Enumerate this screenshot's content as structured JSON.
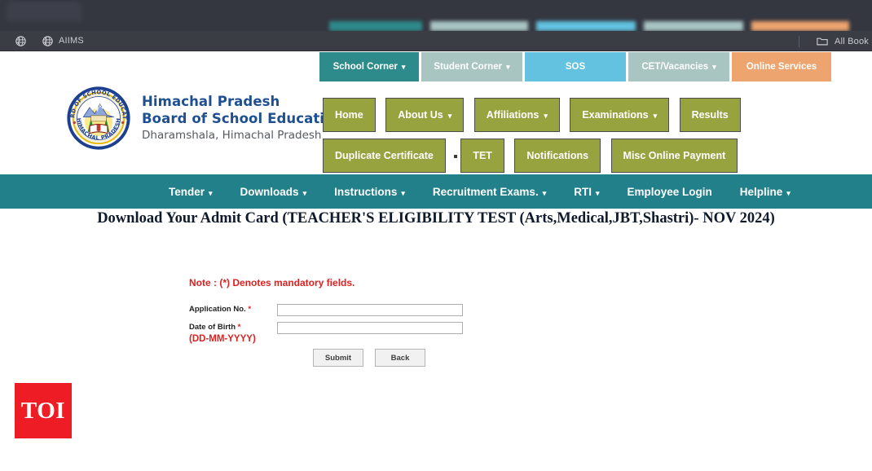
{
  "browser": {
    "bookmarks": [
      {
        "icon": "globe-icon",
        "label": ""
      },
      {
        "icon": "globe-icon",
        "label": "AIIMS"
      }
    ],
    "all_bookmarks_label": "All Book",
    "all_bookmarks_icon": "folder-icon"
  },
  "top_nav": {
    "items": [
      {
        "label": "School Corner",
        "caret": true,
        "color": "#2e8b8b"
      },
      {
        "label": "Student Corner",
        "caret": true,
        "color": "#a9c5c2"
      },
      {
        "label": "SOS",
        "caret": false,
        "color": "#62c2e0"
      },
      {
        "label": "CET/Vacancies",
        "caret": true,
        "color": "#a9c5c2"
      },
      {
        "label": "Online Services",
        "caret": false,
        "color": "#eda46e"
      }
    ]
  },
  "header": {
    "logo_name": "board-seal-logo",
    "logo_outer_text_top": "BOARD OF SCHOOL EDUCATION",
    "logo_outer_text_bottom": "HIMACHAL PRADESH",
    "brand_line1": "Himachal Pradesh",
    "brand_line2": "Board of School Education",
    "brand_line3": "Dharamshala, Himachal Pradesh",
    "brand_color": "#1d4f91"
  },
  "main_nav": {
    "button_color": "#97a33f",
    "items": [
      {
        "label": "Home",
        "caret": false
      },
      {
        "label": "About Us",
        "caret": true
      },
      {
        "label": "Affiliations",
        "caret": true
      },
      {
        "label": "Examinations",
        "caret": true
      },
      {
        "label": "Results",
        "caret": false
      },
      {
        "label": "Duplicate Certificate",
        "caret": false
      },
      {
        "label": "TET",
        "caret": false
      },
      {
        "label": "Notifications",
        "caret": false
      },
      {
        "label": "Misc Online Payment",
        "caret": false
      }
    ]
  },
  "sub_nav": {
    "background": "#22808a",
    "items": [
      {
        "label": "Tender",
        "caret": true
      },
      {
        "label": "Downloads",
        "caret": true
      },
      {
        "label": "Instructions",
        "caret": true
      },
      {
        "label": "Recruitment Exams.",
        "caret": true
      },
      {
        "label": "RTI",
        "caret": true
      },
      {
        "label": "Employee Login",
        "caret": false
      },
      {
        "label": "Helpline",
        "caret": true
      }
    ]
  },
  "page": {
    "title": "Download Your Admit Card (TEACHER'S ELIGIBILITY TEST (Arts,Medical,JBT,Shastri)- NOV 2024)",
    "note": "Note  : (*) Denotes mandatory fields.",
    "note_color": "#e02020"
  },
  "form": {
    "fields": [
      {
        "label": "Application No.",
        "required_mark": "*",
        "value": "",
        "placeholder": ""
      },
      {
        "label": "Date of Birth",
        "required_mark": "*",
        "value": "",
        "placeholder": "",
        "hint": "(DD-MM-YYYY)"
      }
    ],
    "submit_label": "Submit",
    "back_label": "Back"
  },
  "watermark": {
    "text": "TOI",
    "color": "#ee1c25"
  }
}
